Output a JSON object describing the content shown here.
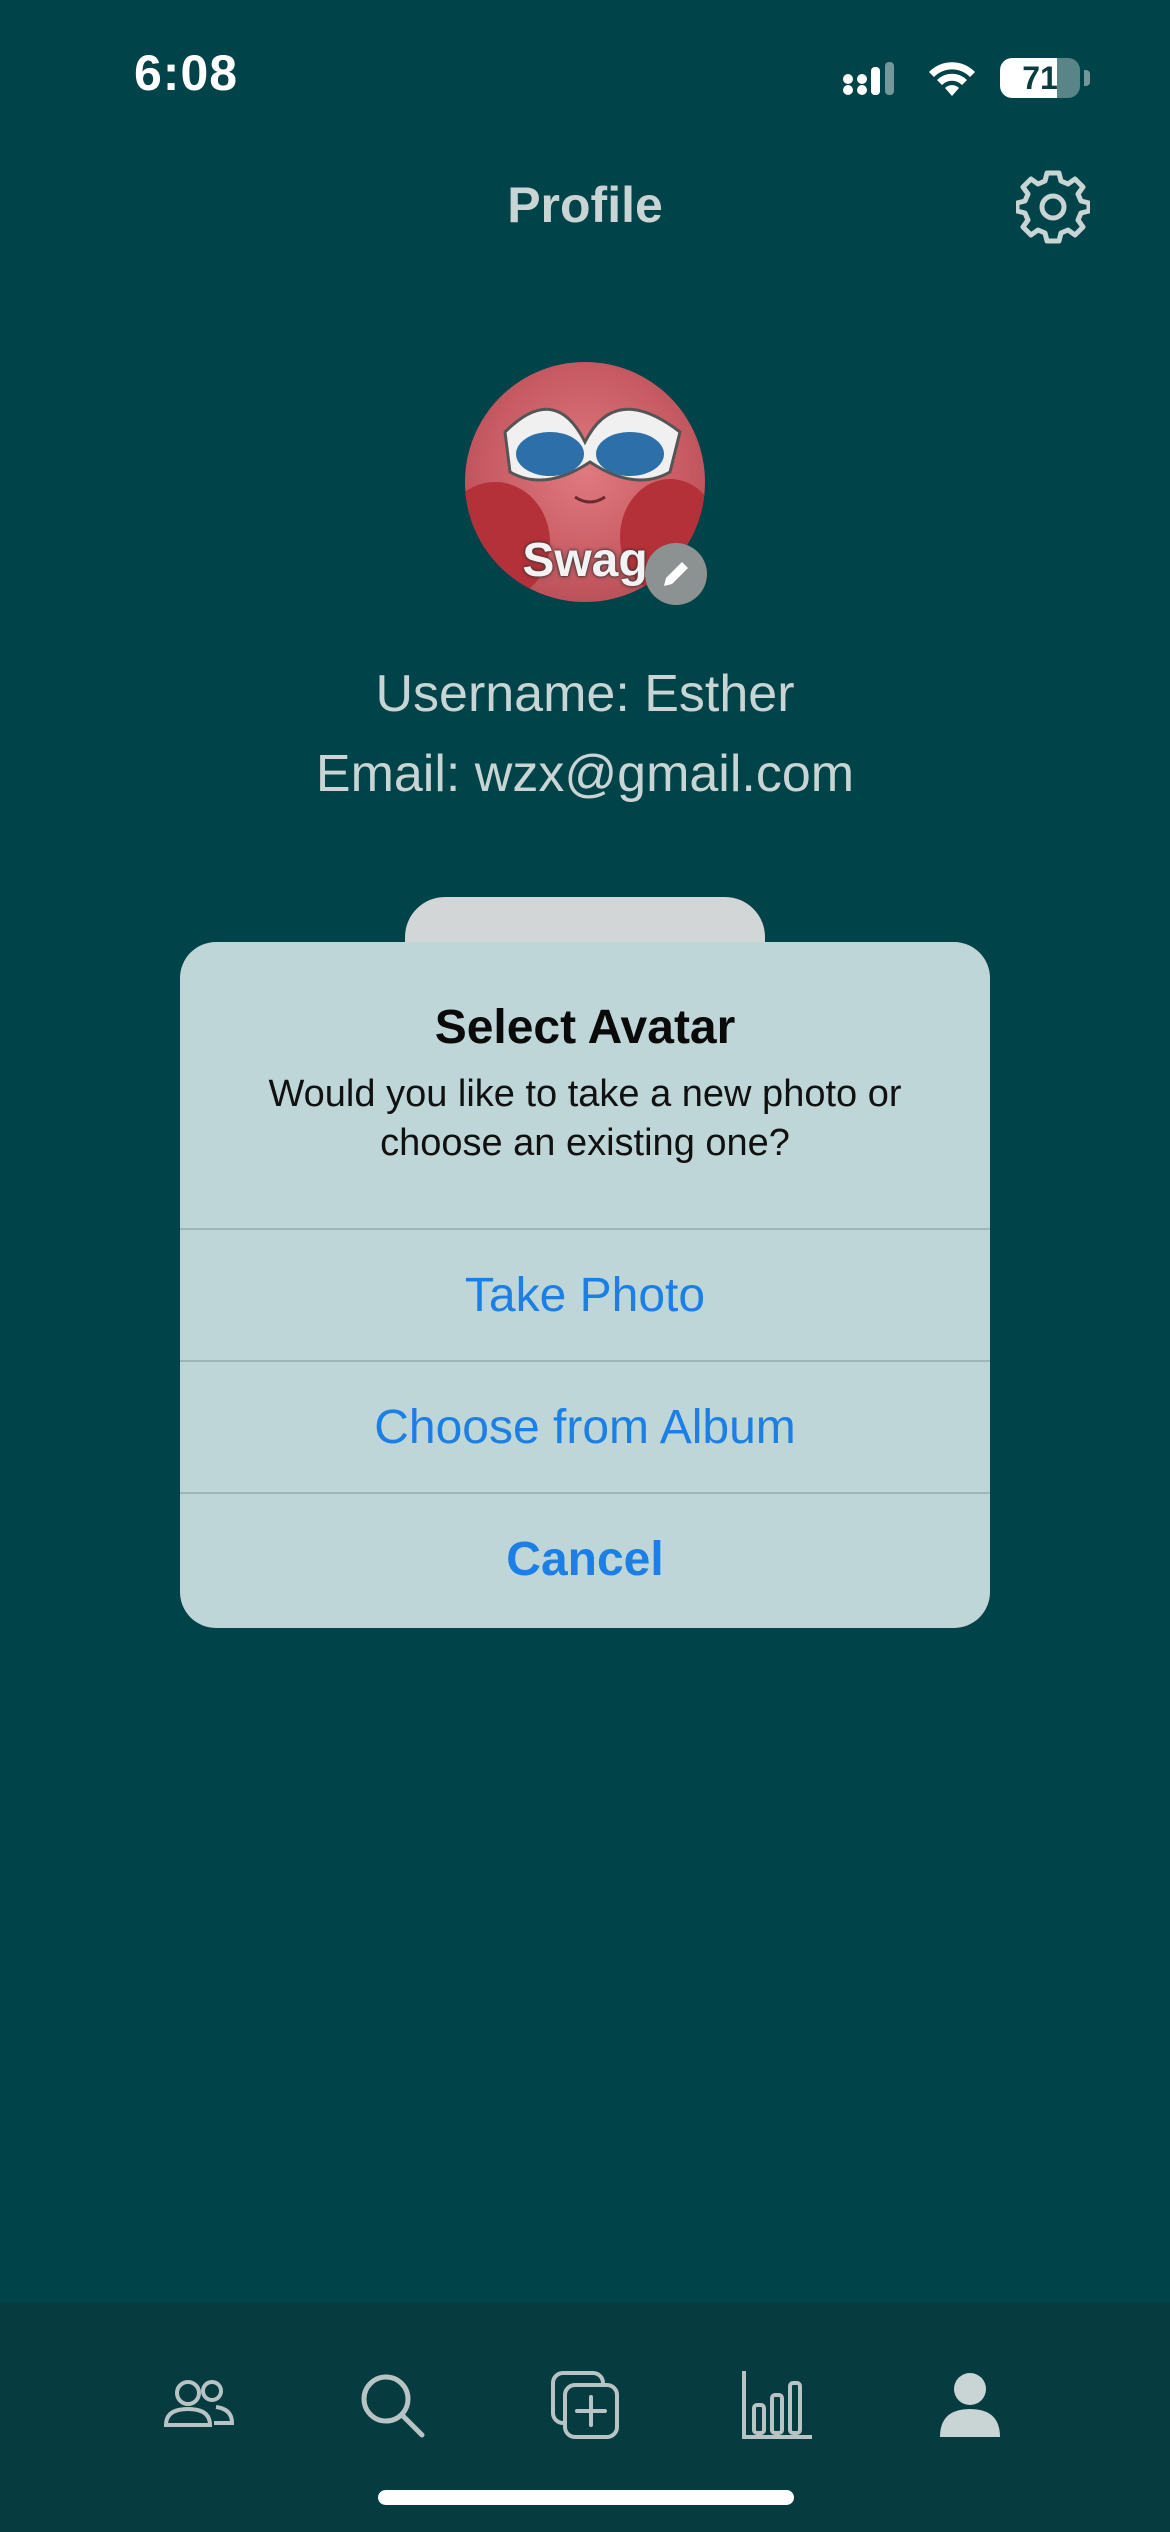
{
  "status_bar": {
    "time": "6:08",
    "battery_level": "71",
    "battery_fraction": 0.71
  },
  "header": {
    "title": "Profile",
    "settings_icon": "gear-icon"
  },
  "profile": {
    "avatar_caption": "Swag",
    "edit_icon": "pencil-icon",
    "username_line": "Username: Esther",
    "email_line": "Email: wzx@gmail.com"
  },
  "alert": {
    "title": "Select Avatar",
    "message_line1": "Would you like to take a new photo or",
    "message_line2": "choose an existing one?",
    "actions": [
      {
        "label": "Take Photo"
      },
      {
        "label": "Choose from Album"
      },
      {
        "label": "Cancel"
      }
    ]
  },
  "tab_bar": {
    "items": [
      {
        "icon": "friends-icon"
      },
      {
        "icon": "search-icon"
      },
      {
        "icon": "add-post-icon"
      },
      {
        "icon": "stats-icon"
      },
      {
        "icon": "profile-icon",
        "active": true
      }
    ]
  },
  "colors": {
    "background": "#004349",
    "tab_bar": "#063c40",
    "alert_bg": "#bed6d8",
    "action_blue": "#1b7fe6"
  }
}
